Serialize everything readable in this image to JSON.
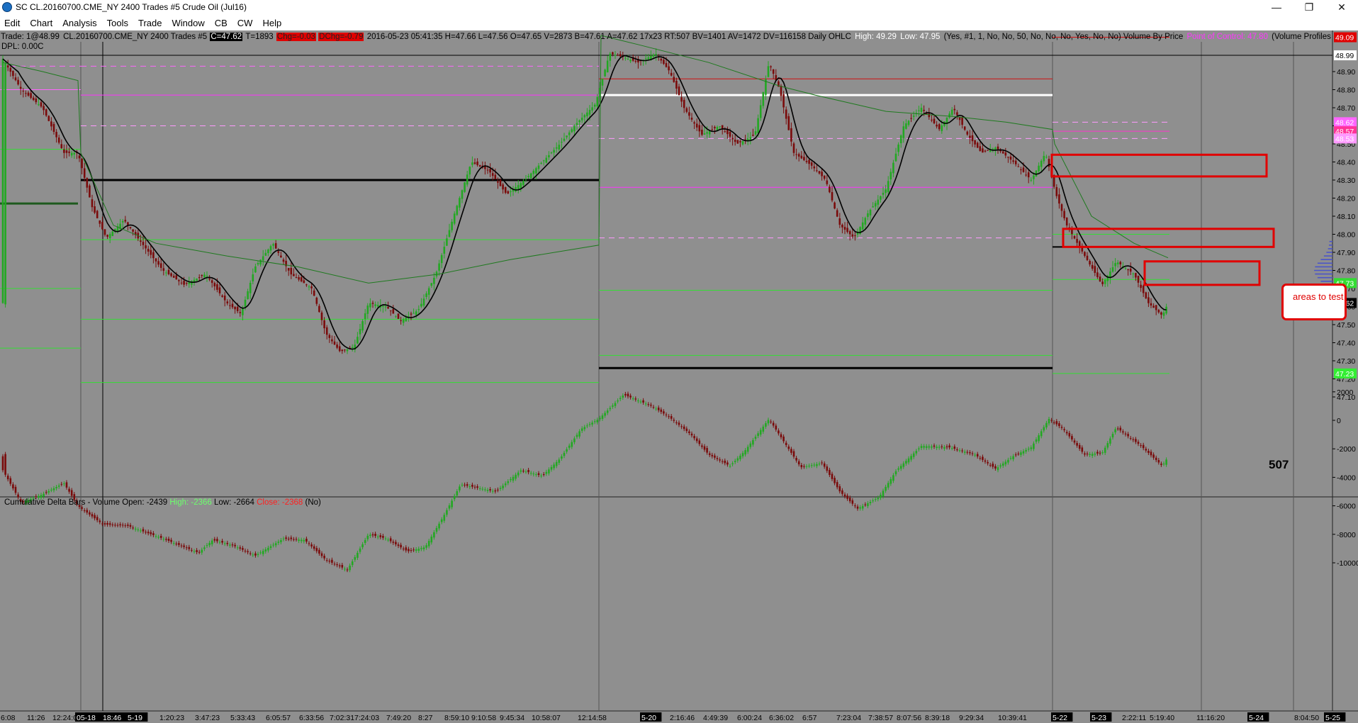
{
  "window": {
    "title": "SC CL.20160700.CME_NY  2400 Trades  #5  Crude Oil (Jul16)",
    "controls": {
      "minimize": "—",
      "maximize": "❐",
      "close": "✕"
    }
  },
  "menu": [
    "Edit",
    "Chart",
    "Analysis",
    "Tools",
    "Trade",
    "Window",
    "CB",
    "CW",
    "Help"
  ],
  "infobar": {
    "trade": "Trade: 1@48.99",
    "symbol": "CL.20160700.CME_NY  2400 Trades  #5",
    "close": "C=47.62",
    "trades": "T=1893",
    "chg": "Chg=-0.03",
    "dchg": "DChg=-0.79",
    "datetime_ohlc": "2016-05-23  05:41:35  H=47.66  L=47.56  O=47.65  V=2873  B=47.61  A=47.62  17x23  RT:507  BV=1401  AV=1472  DV=116158  Daily OHLC",
    "high": "High: 49.29",
    "low": "Low: 47.95",
    "params": "(Yes, #1, 1, No, No, 50, No, No, No, Yes, No, No)  Volume By Price",
    "poc": "Point of Control: 47.80",
    "profile": "(Volume Profiles"
  },
  "dpl": "DPL: 0.00C",
  "lower_panel": {
    "name": "Cumulative Delta Bars - Volume",
    "open": "Open: -2439",
    "high": "High: -2366",
    "low": "Low: -2664",
    "close": "Close: -2368",
    "flag": "(No)"
  },
  "price_axis": {
    "ticks": [
      "48.90",
      "48.80",
      "48.70",
      "48.60",
      "48.50",
      "48.40",
      "48.30",
      "48.20",
      "48.10",
      "48.00",
      "47.90",
      "47.80",
      "47.70",
      "47.60",
      "47.50",
      "47.40",
      "47.30",
      "47.20",
      "47.10"
    ],
    "badges": [
      {
        "value": "49.09",
        "bg": "#e00000",
        "color": "#ffffff"
      },
      {
        "value": "48.99",
        "bg": "#ffffff",
        "color": "#000000"
      },
      {
        "value": "48.62",
        "bg": "#ff66ff",
        "color": "#ffffff"
      },
      {
        "value": "48.57",
        "bg": "#ff3399",
        "color": "#ffffff"
      },
      {
        "value": "48.53",
        "bg": "#ff99ff",
        "color": "#ffffff"
      },
      {
        "value": "47.73",
        "bg": "#33dd33",
        "color": "#ffffff"
      },
      {
        "value": "47.62",
        "bg": "#000000",
        "color": "#ffffff"
      },
      {
        "value": "47.23",
        "bg": "#33ee33",
        "color": "#ffffff"
      }
    ]
  },
  "delta_axis": {
    "ticks": [
      "2000",
      "0",
      "-2000",
      "-4000",
      "-6000",
      "-8000",
      "-10000"
    ]
  },
  "time_axis": {
    "labels": [
      "6:08",
      "11:26",
      "12:24:0",
      "05-18",
      "18:46",
      "5-19",
      "1:20:23",
      "3:47:23",
      "5:33:43",
      "6:05:57",
      "6:33:56",
      "7:02:31",
      "7:24:03",
      "7:49:20",
      "8:27",
      "8:59:10",
      "9:10:58",
      "9:45:34",
      "10:58:07",
      "12:14:58",
      "5-20",
      "2:16:46",
      "4:49:39",
      "6:00:24",
      "6:36:02",
      "6:57",
      "7:23:04",
      "7:38:57",
      "8:07:56",
      "8:39:18",
      "9:29:34",
      "10:39:41",
      "5-22",
      "5-23",
      "2:22:11",
      "5:19:40",
      "11:16:20",
      "5-24",
      "8:04:50",
      "5-25"
    ]
  },
  "annotation": {
    "callout_text": "areas to test",
    "bar_count": "507"
  },
  "colors": {
    "background": "#8f8f8f",
    "up_bar": "#22a822",
    "down_bar": "#7a0b0b",
    "ma": "#000000",
    "vwap": "#1f7a1f",
    "annotation": "#e00000"
  }
}
